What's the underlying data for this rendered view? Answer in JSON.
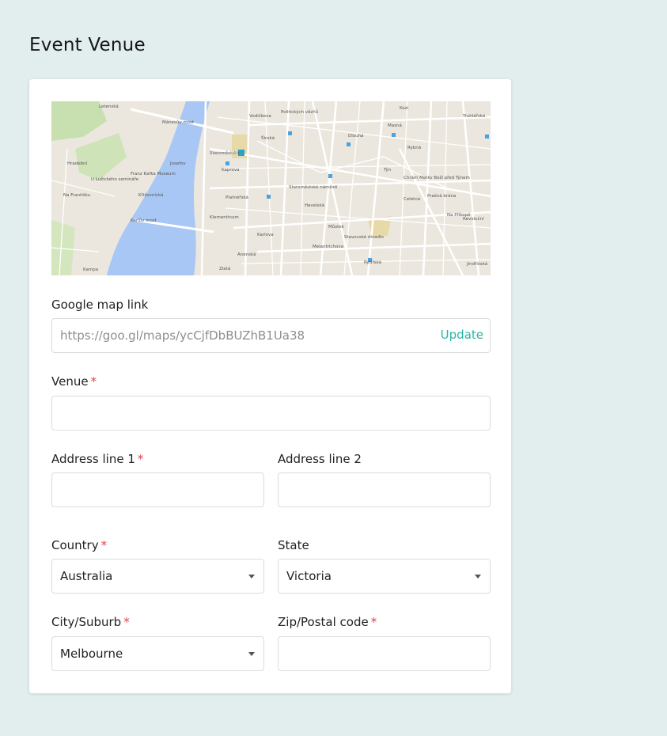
{
  "page": {
    "title": "Event Venue"
  },
  "map": {
    "streets": [
      "Letenská",
      "Mánesův most",
      "Staroměstská",
      "Staroměstské náměstí",
      "Franz Kafka Museum",
      "Karlův most",
      "Klementinum",
      "Karlova",
      "Platnéřská",
      "Dlouhá",
      "Masná",
      "Týn",
      "Chrám Matky Boží před Týnem",
      "Celetná",
      "Prašná brána",
      "Na Příkopě",
      "Stavovské divadlo",
      "Zlatá",
      "Anenská",
      "Kampa",
      "Kaprova",
      "Široká",
      "Josefov",
      "Revoluční",
      "Jindřišská",
      "Havelská",
      "Rytířská",
      "Melantrichova",
      "Na Františku",
      "Vodičkova",
      "U Lužického semináře",
      "Křižovnická",
      "Kozí",
      "Rybná",
      "Hradební",
      "Politických vězňů",
      "Můstek",
      "Truhlářská"
    ]
  },
  "form": {
    "map_link": {
      "label": "Google map link",
      "value": "https://goo.gl/maps/ycCjfDbBUZhB1Ua38",
      "action": "Update"
    },
    "venue": {
      "label": "Venue",
      "required": "*",
      "value": ""
    },
    "address1": {
      "label": "Address line 1",
      "required": "*",
      "value": ""
    },
    "address2": {
      "label": "Address line 2",
      "value": ""
    },
    "country": {
      "label": "Country",
      "required": "*",
      "value": "Australia"
    },
    "state": {
      "label": "State",
      "value": "Victoria"
    },
    "city": {
      "label": "City/Suburb",
      "required": "*",
      "value": "Melbourne"
    },
    "zip": {
      "label": "Zip/Postal code",
      "required": "*",
      "value": ""
    }
  },
  "colors": {
    "accent": "#2bb3a3",
    "required": "#e0414e",
    "background": "#e2eeee"
  }
}
